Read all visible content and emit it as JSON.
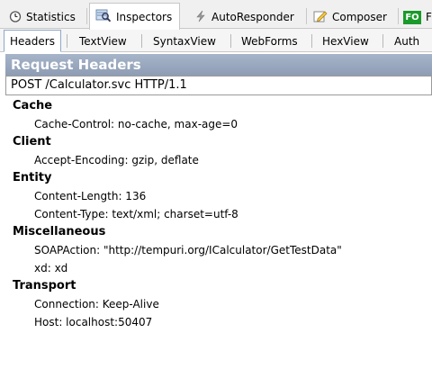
{
  "top_tabs": [
    {
      "label": "Statistics",
      "icon": "stopwatch-icon"
    },
    {
      "label": "Inspectors",
      "icon": "magnifier-icon"
    },
    {
      "label": "AutoResponder",
      "icon": "lightning-icon"
    },
    {
      "label": "Composer",
      "icon": "pencil-icon"
    },
    {
      "label": "F",
      "icon": "fo-icon",
      "badge": "FO"
    }
  ],
  "sub_tabs": [
    "Headers",
    "TextView",
    "SyntaxView",
    "WebForms",
    "HexView",
    "Auth"
  ],
  "request_headers_title": "Request Headers",
  "request_line": "POST /Calculator.svc HTTP/1.1",
  "groups": [
    {
      "name": "Cache",
      "items": [
        "Cache-Control: no-cache, max-age=0"
      ]
    },
    {
      "name": "Client",
      "items": [
        "Accept-Encoding: gzip, deflate"
      ]
    },
    {
      "name": "Entity",
      "items": [
        "Content-Length: 136",
        "Content-Type: text/xml; charset=utf-8"
      ]
    },
    {
      "name": "Miscellaneous",
      "items": [
        "SOAPAction: \"http://tempuri.org/ICalculator/GetTestData\"",
        "xd: xd"
      ]
    },
    {
      "name": "Transport",
      "items": [
        "Connection: Keep-Alive",
        "Host: localhost:50407"
      ]
    }
  ],
  "colors": {
    "header_bar": "#9aa9c0",
    "fo_badge": "#1a9a2a"
  }
}
